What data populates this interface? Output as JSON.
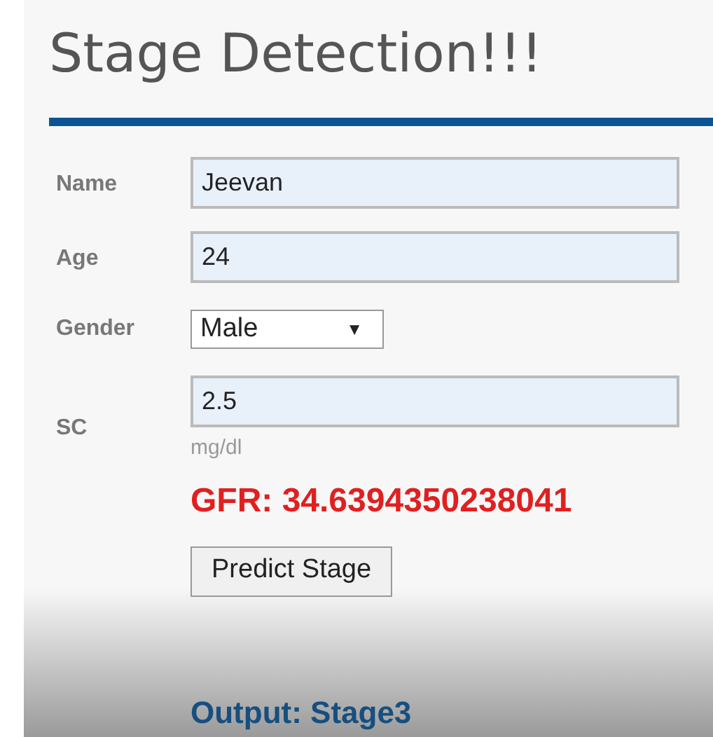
{
  "title": "Stage Detection!!!",
  "fields": [
    {
      "kind": "text",
      "label": "Name",
      "value": "Jeevan"
    },
    {
      "kind": "text",
      "label": "Age",
      "value": "24"
    },
    {
      "kind": "select",
      "label": "Gender",
      "value": "Male",
      "arrow": "▼"
    },
    {
      "kind": "text",
      "label": "SC",
      "value": "2.5",
      "unit": "mg/dl"
    }
  ],
  "gfr": "GFR: 34.6394350238041",
  "button": "Predict Stage",
  "output": "Output: Stage3"
}
